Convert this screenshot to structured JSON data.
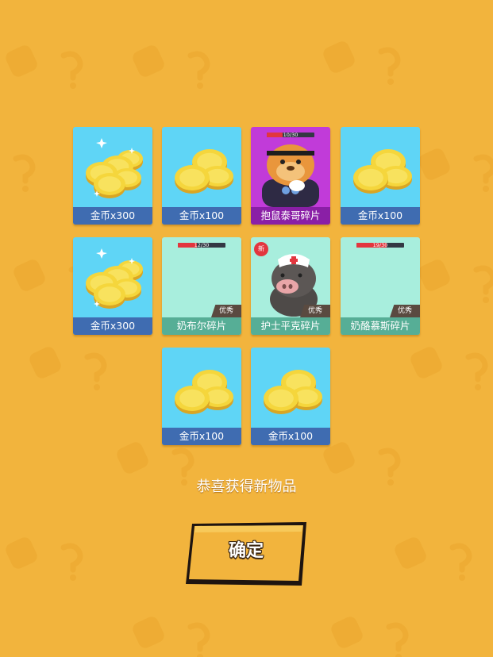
{
  "background_color": "#F2B43D",
  "rewards": [
    {
      "label": "金币x300",
      "type": "coin-pile-large",
      "theme": "blue"
    },
    {
      "label": "金币x100",
      "type": "coin-pile-small",
      "theme": "blue"
    },
    {
      "label": "抱鼠泰哥碎片",
      "type": "character-fragment",
      "theme": "purple",
      "progress": {
        "current": 10,
        "total": 30,
        "text": "10/30"
      }
    },
    {
      "label": "金币x100",
      "type": "coin-pile-small",
      "theme": "blue"
    },
    {
      "label": "金币x300",
      "type": "coin-pile-large",
      "theme": "blue"
    },
    {
      "label": "奶布尔碎片",
      "type": "character-fragment",
      "theme": "mint",
      "quality": "优秀",
      "progress": {
        "current": 12,
        "total": 30,
        "text": "12/30"
      }
    },
    {
      "label": "护士平克碎片",
      "type": "character-fragment",
      "theme": "mint",
      "quality": "优秀",
      "badge": "新"
    },
    {
      "label": "奶酪慕斯碎片",
      "type": "character-fragment",
      "theme": "mint",
      "quality": "优秀",
      "progress": {
        "current": 19,
        "total": 30,
        "text": "19/30"
      }
    },
    {
      "label": "金币x100",
      "type": "coin-pile-small",
      "theme": "blue"
    },
    {
      "label": "金币x100",
      "type": "coin-pile-small",
      "theme": "blue"
    }
  ],
  "message": "恭喜获得新物品",
  "confirm_label": "确定",
  "colors": {
    "coin": "#F5D63C",
    "blue_card": "#5FD5F6",
    "purple_card": "#C13BD9",
    "mint_card": "#A8EEDD",
    "button": "#F2B43D"
  }
}
